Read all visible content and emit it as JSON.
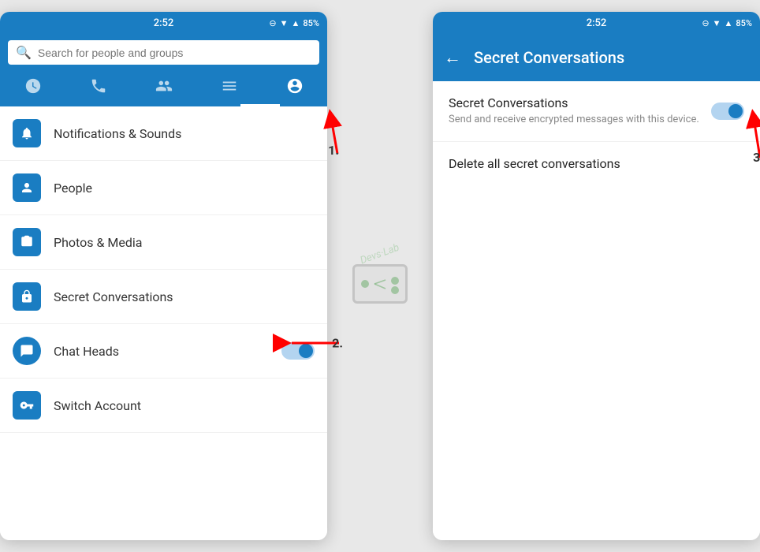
{
  "left_phone": {
    "status_bar": {
      "time": "2:52",
      "battery": "85%"
    },
    "search": {
      "placeholder": "Search for people and groups"
    },
    "tabs": [
      {
        "icon": "clock",
        "label": "Recent",
        "active": false
      },
      {
        "icon": "phone",
        "label": "Calls",
        "active": false
      },
      {
        "icon": "people",
        "label": "People",
        "active": false
      },
      {
        "icon": "menu",
        "label": "Menu",
        "active": false
      },
      {
        "icon": "account",
        "label": "Account",
        "active": true
      }
    ],
    "menu_items": [
      {
        "icon": "bell",
        "label": "Notifications & Sounds",
        "has_toggle": false
      },
      {
        "icon": "person",
        "label": "People",
        "has_toggle": false
      },
      {
        "icon": "camera",
        "label": "Photos & Media",
        "has_toggle": false
      },
      {
        "icon": "lock",
        "label": "Secret Conversations",
        "has_toggle": false
      },
      {
        "icon": "chat-heads",
        "label": "Chat Heads",
        "has_toggle": true,
        "toggle_on": true
      },
      {
        "icon": "key",
        "label": "Switch Account",
        "has_toggle": false
      }
    ],
    "annotations": {
      "arrow1_label": "1.",
      "arrow2_label": "2."
    }
  },
  "right_phone": {
    "status_bar": {
      "time": "2:52",
      "battery": "85%"
    },
    "header": {
      "title": "Secret Conversations",
      "back_label": "←"
    },
    "settings": [
      {
        "title": "Secret Conversations",
        "description": "Send and receive encrypted messages with this device.",
        "has_toggle": true,
        "toggle_on": true
      },
      {
        "title": "Delete all secret conversations",
        "description": "",
        "has_toggle": false,
        "toggle_on": false
      }
    ],
    "annotations": {
      "arrow3_label": "3."
    }
  }
}
